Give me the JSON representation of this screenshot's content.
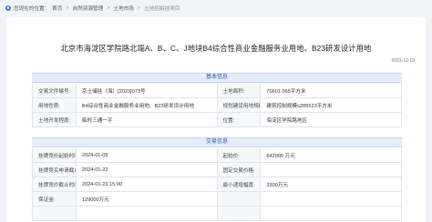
{
  "breadcrumb": {
    "prefix": "您现在的位置：",
    "items": [
      "首页",
      "自然资源管理",
      "土地市场",
      "土地招拍挂项目"
    ]
  },
  "title": "北京市海淀区学院路北端A、B、C、J地块B4综合性商业金融服务业用地、B23研发设计用地",
  "date": "2023-12-19",
  "basic_section": {
    "heading": "基本信息",
    "rows": [
      [
        "交易文件编号:",
        "京土储挂（海）[2023]073号",
        "土地面积:",
        "70601.065平方米"
      ],
      [
        "用地性质:",
        "B4综合性商业金融服务业用地、B23研发设计用地",
        "规划建设用地规模:",
        "建筑控制规模≤285523平方米"
      ],
      [
        "土地开发程度:",
        "临时三通一平",
        "位置:",
        "海淀区学院路地区"
      ]
    ]
  },
  "trade_section": {
    "heading": "交易信息",
    "rows": [
      [
        "挂牌竞价起始时间:",
        "2024-01-09",
        "起始价:",
        "642000 万元"
      ],
      [
        "挂牌竞买申请截止时间:",
        "2024-01-22",
        "固定交易价格:",
        ""
      ],
      [
        "挂牌竞价截止时间:",
        "2024-01-23 15:00",
        "最小递增幅度:",
        "3300万元"
      ],
      [
        "保证金:",
        "129000万元",
        "",
        ""
      ],
      [
        "",
        "",
        "",
        ""
      ]
    ]
  }
}
